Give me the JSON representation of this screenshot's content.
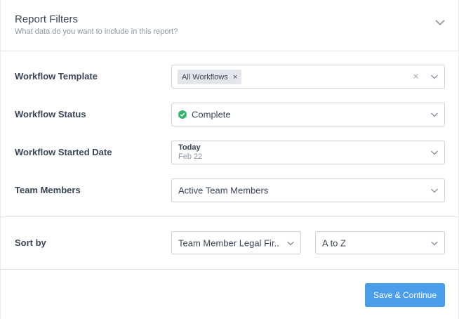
{
  "header": {
    "title": "Report Filters",
    "subtitle": "What data do you want to include in this report?"
  },
  "filters": {
    "workflow_template": {
      "label": "Workflow Template",
      "chip": "All Workflows",
      "chip_remove": "×",
      "clear": "×"
    },
    "workflow_status": {
      "label": "Workflow Status",
      "value": "Complete",
      "status_color": "#2fb86b"
    },
    "workflow_started_date": {
      "label": "Workflow Started Date",
      "value_primary": "Today",
      "value_secondary": "Feb 22"
    },
    "team_members": {
      "label": "Team Members",
      "value": "Active Team Members"
    }
  },
  "sort": {
    "label": "Sort by",
    "field": "Team Member Legal Fir...",
    "order": "A to Z"
  },
  "footer": {
    "save_label": "Save & Continue",
    "accent": "#4a9de8"
  }
}
